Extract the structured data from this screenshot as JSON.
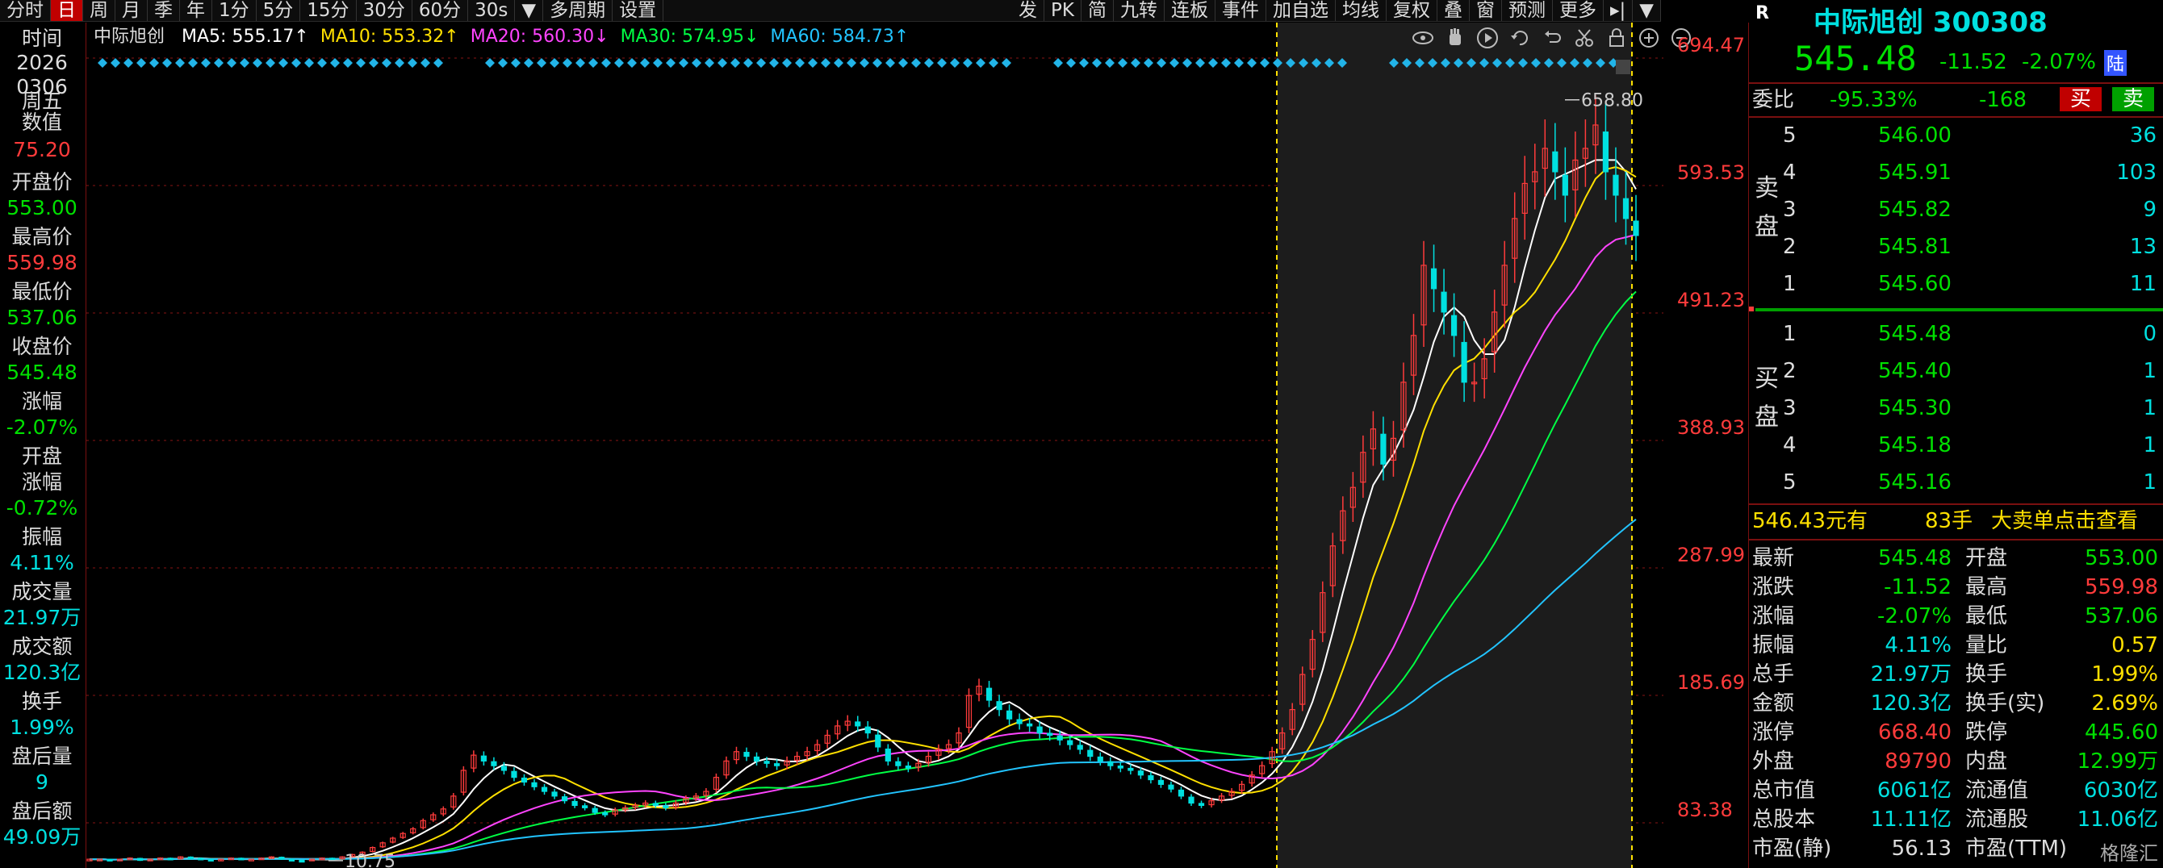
{
  "toolbar": {
    "periods": [
      "分时",
      "日",
      "周",
      "月",
      "季",
      "年",
      "1分",
      "5分",
      "15分",
      "30分",
      "60分",
      "30s",
      "多周期",
      "设置"
    ],
    "active": "日",
    "tools": [
      "发",
      "PK",
      "简",
      "九转",
      "连板",
      "事件",
      "加自选",
      "均线",
      "复权",
      "叠",
      "窗",
      "预测",
      "更多"
    ]
  },
  "left_panel": {
    "time_label": "时间",
    "date_year": "2026",
    "date_md": "0306",
    "weekday": "周五",
    "value_label": "数值",
    "value": "75.20",
    "open_label": "开盘价",
    "open": "553.00",
    "high_label": "最高价",
    "high": "559.98",
    "low_label": "最低价",
    "low": "537.06",
    "close_label": "收盘价",
    "close": "545.48",
    "chg_label": "涨幅",
    "chg": "-2.07%",
    "open_chg_label1": "开盘",
    "open_chg_label2": "涨幅",
    "open_chg": "-0.72%",
    "amp_label": "振幅",
    "amp": "4.11%",
    "vol_label": "成交量",
    "vol": "21.97万",
    "amt_label": "成交额",
    "amt": "120.3亿",
    "turn_label": "换手",
    "turn": "1.99%",
    "after_vol_label": "盘后量",
    "after_vol": "9",
    "after_amt_label": "盘后额",
    "after_amt": "49.09万"
  },
  "chart": {
    "stock_name": "中际旭创",
    "ma": [
      {
        "label": "MA5: 555.17↑",
        "color": "#ffffff"
      },
      {
        "label": "MA10: 553.32↑",
        "color": "#ffe000"
      },
      {
        "label": "MA20: 560.30↓",
        "color": "#ff44ff"
      },
      {
        "label": "MA30: 574.95↓",
        "color": "#00ff44"
      },
      {
        "label": "MA60: 584.73↑",
        "color": "#22c4ff"
      }
    ],
    "icons": [
      "eye-icon",
      "hand-icon",
      "play-icon",
      "replay-icon",
      "undo-icon",
      "scissors-icon",
      "lock-icon",
      "zoom-in-icon",
      "zoom-out-icon"
    ],
    "max_label": "658.80",
    "min_label": "10.75"
  },
  "chart_data": {
    "type": "candlestick",
    "y_axis_ticks": [
      "694.47",
      "593.53",
      "491.23",
      "388.93",
      "287.99",
      "185.69",
      "83.38"
    ],
    "ylim": [
      10,
      700
    ],
    "high_marker": 658.8,
    "low_marker": 10.75,
    "last_close": 545.48,
    "close_series": [
      12,
      12,
      11,
      12,
      13,
      11,
      12,
      13,
      12,
      14,
      13,
      12,
      11,
      12,
      13,
      12,
      12,
      13,
      14,
      12,
      11,
      10.75,
      12,
      13,
      12,
      14,
      16,
      18,
      22,
      26,
      30,
      34,
      38,
      45,
      50,
      55,
      66,
      88,
      101,
      96,
      92,
      88,
      82,
      78,
      74,
      70,
      66,
      62,
      58,
      56,
      52,
      50,
      54,
      56,
      58,
      60,
      58,
      56,
      60,
      64,
      66,
      70,
      82,
      96,
      104,
      100,
      96,
      94,
      92,
      96,
      100,
      104,
      110,
      118,
      126,
      130,
      126,
      120,
      108,
      96,
      92,
      90,
      94,
      100,
      106,
      110,
      120,
      152,
      160,
      148,
      140,
      132,
      128,
      126,
      120,
      118,
      114,
      110,
      106,
      100,
      96,
      92,
      90,
      88,
      84,
      80,
      76,
      72,
      66,
      60,
      58,
      62,
      66,
      70,
      76,
      84,
      92,
      104,
      120,
      140,
      170,
      200,
      240,
      280,
      310,
      330,
      360,
      380,
      350,
      372,
      420,
      460,
      520,
      500,
      480,
      460,
      420,
      420,
      440,
      480,
      520,
      560,
      590,
      600,
      620,
      600,
      580,
      610,
      620,
      640,
      600,
      580,
      560,
      545.48
    ]
  },
  "quote": {
    "r_label": "R",
    "name": "中际旭创",
    "code": "300308",
    "price": "545.48",
    "change": "-11.52",
    "change_pct": "-2.07%",
    "lu": "陆",
    "wb_label": "委比",
    "wb": "-95.33%",
    "wc": "-168",
    "buy": "买",
    "sell": "卖",
    "sell_side_label": "卖盘",
    "buy_side_label": "买盘",
    "asks": [
      {
        "lvl": "5",
        "price": "546.00",
        "vol": "36"
      },
      {
        "lvl": "4",
        "price": "545.91",
        "vol": "103"
      },
      {
        "lvl": "3",
        "price": "545.82",
        "vol": "9"
      },
      {
        "lvl": "2",
        "price": "545.81",
        "vol": "13"
      },
      {
        "lvl": "1",
        "price": "545.60",
        "vol": "11"
      }
    ],
    "bids": [
      {
        "lvl": "1",
        "price": "545.48",
        "vol": "0"
      },
      {
        "lvl": "2",
        "price": "545.40",
        "vol": "1"
      },
      {
        "lvl": "3",
        "price": "545.30",
        "vol": "1"
      },
      {
        "lvl": "4",
        "price": "545.18",
        "vol": "1"
      },
      {
        "lvl": "5",
        "price": "545.16",
        "vol": "1"
      }
    ],
    "big_price": "546.43元有",
    "big_lots": "83手",
    "big_label": "大卖单",
    "big_link": "点击查看",
    "stats": [
      {
        "l1": "最新",
        "v1": "545.48",
        "c1": "green",
        "l2": "开盘",
        "v2": "553.00",
        "c2": "green"
      },
      {
        "l1": "涨跌",
        "v1": "-11.52",
        "c1": "green",
        "l2": "最高",
        "v2": "559.98",
        "c2": "red"
      },
      {
        "l1": "涨幅",
        "v1": "-2.07%",
        "c1": "green",
        "l2": "最低",
        "v2": "537.06",
        "c2": "green"
      },
      {
        "l1": "振幅",
        "v1": "4.11%",
        "c1": "cyan",
        "l2": "量比",
        "v2": "0.57",
        "c2": "yellow"
      },
      {
        "l1": "总手",
        "v1": "21.97万",
        "c1": "cyan",
        "l2": "换手",
        "v2": "1.99%",
        "c2": "yellow"
      },
      {
        "l1": "金额",
        "v1": "120.3亿",
        "c1": "cyan",
        "l2": "换手(实)",
        "v2": "2.69%",
        "c2": "yellow"
      },
      {
        "l1": "涨停",
        "v1": "668.40",
        "c1": "red",
        "l2": "跌停",
        "v2": "445.60",
        "c2": "green"
      },
      {
        "l1": "外盘",
        "v1": "89790",
        "c1": "red",
        "l2": "内盘",
        "v2": "12.99万",
        "c2": "green"
      },
      {
        "l1": "总市值",
        "v1": "6061亿",
        "c1": "cyan",
        "l2": "流通值",
        "v2": "6030亿",
        "c2": "cyan"
      },
      {
        "l1": "总股本",
        "v1": "11.11亿",
        "c1": "cyan",
        "l2": "流通股",
        "v2": "11.06亿",
        "c2": "cyan"
      },
      {
        "l1": "市盈(静)",
        "v1": "56.13",
        "c1": "white",
        "l2": "市盈(TTM)",
        "v2": "",
        "c2": "white"
      }
    ],
    "watermark": "格隆汇"
  },
  "colors": {
    "up": "#ff3b3b",
    "down": "#00e0e0",
    "axis_red": "#7a1010"
  }
}
